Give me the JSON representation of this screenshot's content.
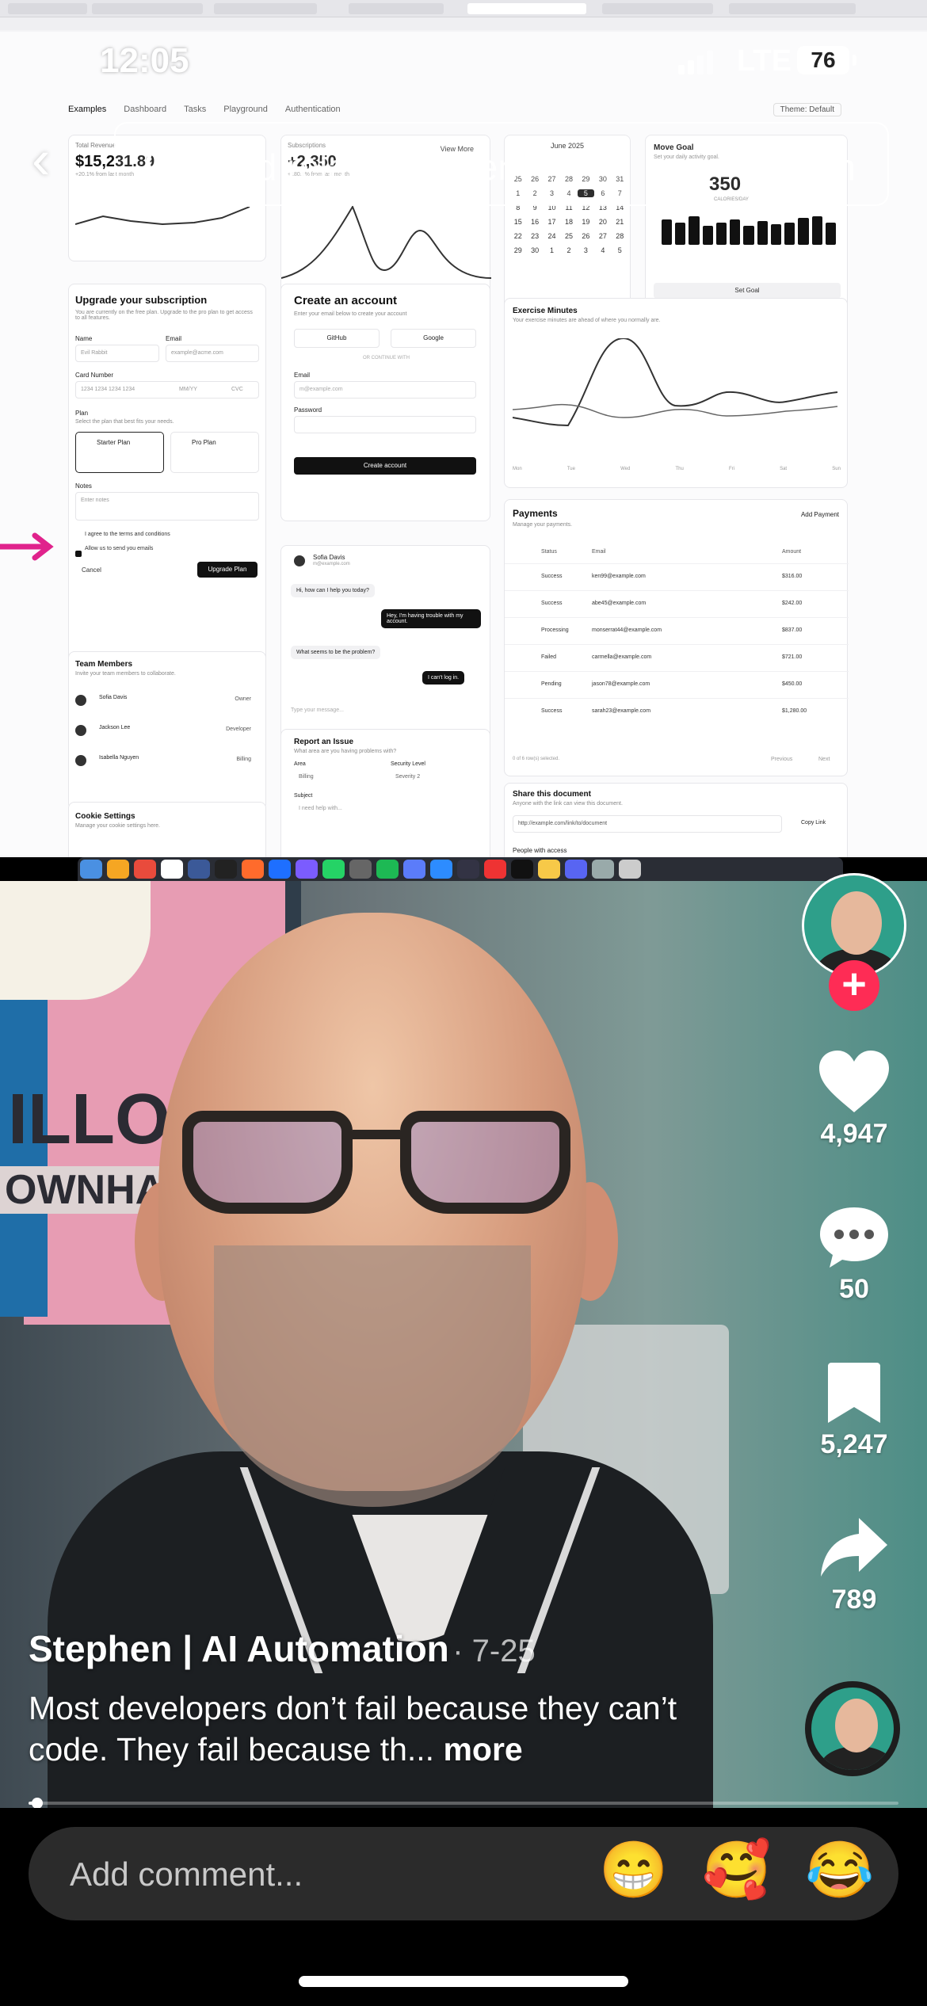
{
  "status_bar": {
    "time": "12:05",
    "network": "LTE",
    "battery": "76"
  },
  "search": {
    "placeholder": "Find related content",
    "button": "Search"
  },
  "recording": {
    "nav": [
      "Examples",
      "Dashboard",
      "Tasks",
      "Playground",
      "Authentication"
    ],
    "theme": "Theme: Default",
    "revenue": {
      "label": "Total Revenue",
      "value": "$15,231.89",
      "sub": "+20.1% from last month"
    },
    "subscriptions": {
      "label": "Subscriptions",
      "value": "+2,350",
      "sub": "+180.1% from last month",
      "link": "View More"
    },
    "calendar": {
      "month": "June 2025",
      "days": [
        "25",
        "26",
        "27",
        "28",
        "29",
        "30",
        "31",
        "1",
        "2",
        "3",
        "4",
        "5",
        "6",
        "7",
        "8",
        "9",
        "10",
        "11",
        "12",
        "13",
        "14",
        "15",
        "16",
        "17",
        "18",
        "19",
        "20",
        "21",
        "22",
        "23",
        "24",
        "25",
        "26",
        "27",
        "28",
        "29",
        "30",
        "1",
        "2",
        "3",
        "4",
        "5"
      ]
    },
    "move_goal": {
      "title": "Move Goal",
      "sub": "Set your daily activity goal.",
      "value": "350",
      "unit": "CALORIES/DAY",
      "button": "Set Goal"
    },
    "subscription": {
      "title": "Upgrade your subscription",
      "sub": "You are currently on the free plan. Upgrade to the pro plan to get access to all features.",
      "name_label": "Name",
      "name_value": "Evil Rabbit",
      "email_label": "Email",
      "email_value": "example@acme.com",
      "card_label": "Card Number",
      "card_value": "1234 1234 1234 1234",
      "mm": "MM/YY",
      "cvc": "CVC",
      "plan_label": "Plan",
      "plan_sub": "Select the plan that best fits your needs.",
      "plan_a": "Starter Plan",
      "plan_b": "Pro Plan",
      "notes_label": "Notes",
      "notes_ph": "Enter notes",
      "terms": "I agree to the terms and conditions",
      "emails": "Allow us to send you emails",
      "cancel": "Cancel",
      "upgrade": "Upgrade Plan"
    },
    "account": {
      "title": "Create an account",
      "sub": "Enter your email below to create your account",
      "github": "GitHub",
      "google": "Google",
      "or": "OR CONTINUE WITH",
      "email_label": "Email",
      "email_ph": "m@example.com",
      "password_label": "Password",
      "button": "Create account"
    },
    "chat": {
      "name": "Sofia Davis",
      "email": "m@example.com",
      "messages": [
        "Hi, how can I help you today?",
        "Hey, I'm having trouble with my account.",
        "What seems to be the problem?",
        "I can't log in."
      ],
      "input_ph": "Type your message..."
    },
    "exercise": {
      "title": "Exercise Minutes",
      "sub": "Your exercise minutes are ahead of where you normally are.",
      "days": [
        "Mon",
        "Tue",
        "Wed",
        "Thu",
        "Fri",
        "Sat",
        "Sun"
      ]
    },
    "payments": {
      "title": "Payments",
      "sub": "Manage your payments.",
      "button": "Add Payment",
      "cols": [
        "Status",
        "Email",
        "Amount"
      ],
      "rows": [
        [
          "Success",
          "ken99@example.com",
          "$316.00"
        ],
        [
          "Success",
          "abe45@example.com",
          "$242.00"
        ],
        [
          "Processing",
          "monserrat44@example.com",
          "$837.00"
        ],
        [
          "Failed",
          "carmella@example.com",
          "$721.00"
        ],
        [
          "Pending",
          "jason78@example.com",
          "$450.00"
        ],
        [
          "Success",
          "sarah23@example.com",
          "$1,280.00"
        ]
      ],
      "footer": "0 of 6 row(s) selected.",
      "prev": "Previous",
      "next": "Next"
    },
    "team": {
      "title": "Team Members",
      "sub": "Invite your team members to collaborate.",
      "members": [
        [
          "Sofia Davis",
          "Owner"
        ],
        [
          "Jackson Lee",
          "Developer"
        ],
        [
          "Isabella Nguyen",
          "Billing"
        ]
      ]
    },
    "cookies": {
      "title": "Cookie Settings",
      "sub": "Manage your cookie settings here."
    },
    "report": {
      "title": "Report an Issue",
      "sub": "What area are you having problems with?",
      "area_label": "Area",
      "area_value": "Billing",
      "sev_label": "Security Level",
      "sev_value": "Severity 2",
      "subject_label": "Subject",
      "subject_ph": "I need help with..."
    },
    "share": {
      "title": "Share this document",
      "sub": "Anyone with the link can view this document.",
      "link": "http://example.com/link/to/document",
      "button": "Copy Link",
      "people": "People with access"
    }
  },
  "video": {
    "author": "Stephen | AI Automation",
    "date": "· 7-25",
    "description": "Most developers don’t fail because they can’t code. They fail because th...",
    "more": "more",
    "progress": 0.01
  },
  "actions": {
    "likes": "4,947",
    "comments": "50",
    "saves": "5,247",
    "shares": "789"
  },
  "comment_bar": {
    "placeholder": "Add comment...",
    "emojis": [
      "😁",
      "🥰",
      "😂"
    ]
  },
  "colors": {
    "follow": "#fe2c55",
    "comment_bg": "#2b2b2b"
  }
}
